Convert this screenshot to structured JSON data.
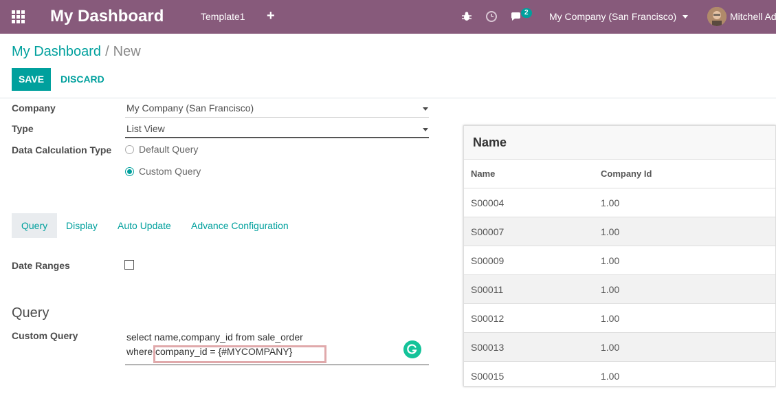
{
  "navbar": {
    "app_title": "My Dashboard",
    "menu": [
      "Template1"
    ],
    "add_symbol": "+",
    "messages_badge": "2",
    "company": "My Company (San Francisco)",
    "user": "Mitchell Ad"
  },
  "breadcrumb": {
    "parent": "My Dashboard",
    "separator": "/",
    "current": "New"
  },
  "actions": {
    "save": "SAVE",
    "discard": "DISCARD"
  },
  "form": {
    "company_label": "Company",
    "company_value": "My Company (San Francisco)",
    "type_label": "Type",
    "type_value": "List View",
    "calc_label": "Data Calculation Type",
    "calc_options": [
      "Default Query",
      "Custom Query"
    ],
    "calc_selected": "Custom Query"
  },
  "tabs": [
    "Query",
    "Display",
    "Auto Update",
    "Advance Configuration"
  ],
  "active_tab": "Query",
  "date_ranges_label": "Date Ranges",
  "date_ranges_checked": false,
  "query_section": {
    "title": "Query",
    "label": "Custom Query",
    "line1": "select name,company_id from sale_order",
    "line2": "where company_id = {#MYCOMPANY}"
  },
  "preview": {
    "title": "Name",
    "columns": [
      "Name",
      "Company Id"
    ],
    "rows": [
      [
        "S00004",
        "1.00"
      ],
      [
        "S00007",
        "1.00"
      ],
      [
        "S00009",
        "1.00"
      ],
      [
        "S00011",
        "1.00"
      ],
      [
        "S00012",
        "1.00"
      ],
      [
        "S00013",
        "1.00"
      ],
      [
        "S00015",
        "1.00"
      ]
    ]
  },
  "colors": {
    "navbar": "#875a7b",
    "accent": "#00a09d",
    "badge": "#00a09d",
    "highlight": "#e0a9ab"
  }
}
